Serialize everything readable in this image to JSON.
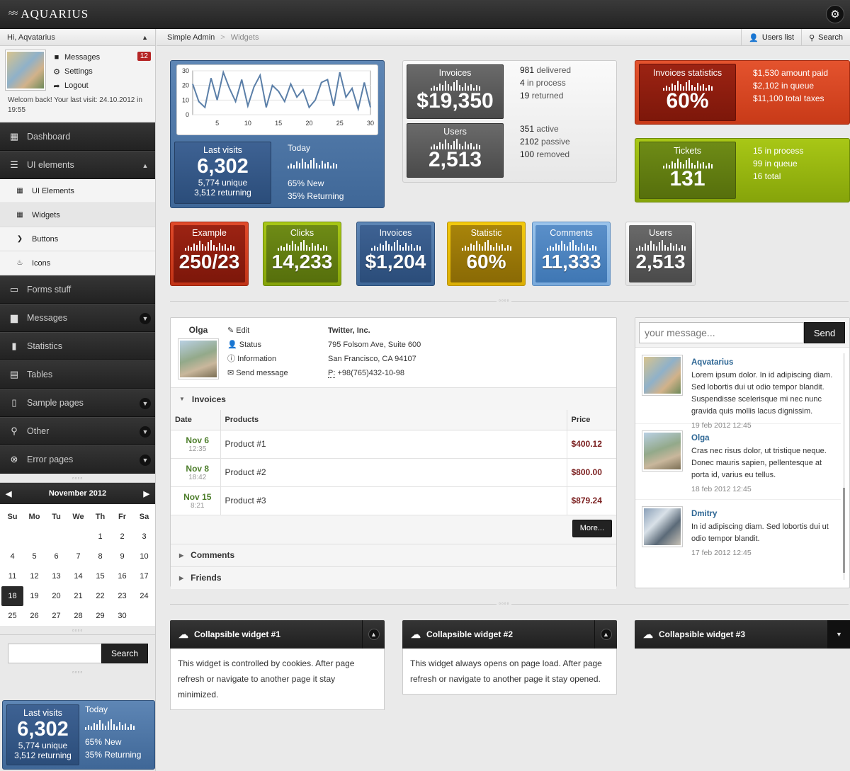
{
  "app": {
    "logo": "AQUARIUS"
  },
  "header": {
    "greeting": "Hi, Aqvatarius"
  },
  "user_box": {
    "messages_label": "Messages",
    "messages_count": "12",
    "settings_label": "Settings",
    "logout_label": "Logout",
    "welcome": "Welcom back! Your last visit: 24.10.2012 in 19:55"
  },
  "nav": {
    "dashboard": "Dashboard",
    "ui_elements": "UI elements",
    "sub": [
      "UI Elements",
      "Widgets",
      "Buttons",
      "Icons"
    ],
    "forms": "Forms stuff",
    "messages": "Messages",
    "statistics": "Statistics",
    "tables": "Tables",
    "sample_pages": "Sample pages",
    "other": "Other",
    "error_pages": "Error pages"
  },
  "calendar": {
    "month": "November 2012",
    "dow": [
      "Su",
      "Mo",
      "Tu",
      "We",
      "Th",
      "Fr",
      "Sa"
    ],
    "days": [
      "",
      "",
      "",
      "",
      "1",
      "2",
      "3",
      "4",
      "5",
      "6",
      "7",
      "8",
      "9",
      "10",
      "11",
      "12",
      "13",
      "14",
      "15",
      "16",
      "17",
      "18",
      "19",
      "20",
      "21",
      "22",
      "23",
      "24",
      "25",
      "26",
      "27",
      "28",
      "29",
      "30",
      ""
    ],
    "today": "18"
  },
  "side_search": {
    "button": "Search"
  },
  "visits": {
    "title": "Last visits",
    "value": "6,302",
    "unique": "5,774 unique",
    "returning": "3,512 returning",
    "today": "Today",
    "new_pct": "65%",
    "new_label": "New",
    "ret_pct": "35%",
    "ret_label": "Returning"
  },
  "breadcrumb": {
    "root": "Simple Admin",
    "current": "Widgets",
    "users_list": "Users list",
    "search": "Search"
  },
  "chart_data": {
    "type": "line",
    "x": [
      1,
      2,
      3,
      4,
      5,
      6,
      7,
      8,
      9,
      10,
      11,
      12,
      13,
      14,
      15,
      16,
      17,
      18,
      19,
      20,
      21,
      22,
      23,
      24,
      25,
      26,
      27,
      28,
      29,
      30
    ],
    "values": [
      21,
      9,
      5,
      25,
      10,
      29,
      18,
      9,
      24,
      6,
      19,
      27,
      5,
      20,
      16,
      9,
      21,
      12,
      17,
      5,
      10,
      22,
      24,
      6,
      29,
      12,
      18,
      4,
      22,
      5
    ],
    "xticks": [
      "5",
      "10",
      "15",
      "20",
      "25",
      "30"
    ],
    "yticks": [
      "0",
      "10",
      "20",
      "30"
    ],
    "ylim": [
      0,
      30
    ],
    "color": "#5b7fa8"
  },
  "invoices_box": {
    "invoices_title": "Invoices",
    "invoices_value": "$19,350",
    "delivered_n": "981",
    "delivered": "delivered",
    "process_n": "4",
    "process": "in process",
    "returned_n": "19",
    "returned": "returned",
    "users_title": "Users",
    "users_value": "2,513",
    "active_n": "351",
    "active": "active",
    "passive_n": "2102",
    "passive": "passive",
    "removed_n": "100",
    "removed": "removed"
  },
  "inv_stats": {
    "title": "Invoices statistics",
    "value": "60%",
    "line1": "$1,530 amount paid",
    "line2": "$2,102 in queue",
    "line3": "$11,100 total taxes"
  },
  "tickets": {
    "title": "Tickets",
    "value": "131",
    "line1": "15 in process",
    "line2": "99 in queue",
    "line3": "16 total"
  },
  "tiles": [
    {
      "title": "Example",
      "value": "250/23"
    },
    {
      "title": "Clicks",
      "value": "14,233"
    },
    {
      "title": "Invoices",
      "value": "$1,204"
    },
    {
      "title": "Statistic",
      "value": "60%"
    },
    {
      "title": "Comments",
      "value": "11,333"
    },
    {
      "title": "Users",
      "value": "2,513"
    }
  ],
  "profile": {
    "name": "Olga",
    "edit": "Edit",
    "status": "Status",
    "information": "Information",
    "send": "Send message",
    "company": "Twitter, Inc.",
    "addr1": "795 Folsom Ave, Suite 600",
    "addr2": "San Francisco, CA 94107",
    "phone_label": "P:",
    "phone": "+98(765)432-10-98"
  },
  "invoices_table": {
    "section": "Invoices",
    "headers": [
      "Date",
      "Products",
      "Price"
    ],
    "rows": [
      {
        "date": "Nov 6",
        "time": "12:35",
        "product": "Product #1",
        "price": "$400.12"
      },
      {
        "date": "Nov 8",
        "time": "18:42",
        "product": "Product #2",
        "price": "$800.00"
      },
      {
        "date": "Nov 15",
        "time": "8:21",
        "product": "Product #3",
        "price": "$879.24"
      }
    ],
    "more": "More...",
    "comments": "Comments",
    "friends": "Friends"
  },
  "chat": {
    "placeholder": "your message...",
    "send": "Send",
    "items": [
      {
        "name": "Aqvatarius",
        "text": "Lorem ipsum dolor. In id adipiscing diam. Sed lobortis dui ut odio tempor blandit. Suspendisse scelerisque mi nec nunc gravida quis mollis lacus dignissim.",
        "time": "19 feb 2012 12:45"
      },
      {
        "name": "Olga",
        "text": "Cras nec risus dolor, ut tristique neque. Donec mauris sapien, pellentesque at porta id, varius eu tellus.",
        "time": "18 feb 2012 12:45"
      },
      {
        "name": "Dmitry",
        "text": "In id adipiscing diam. Sed lobortis dui ut odio tempor blandit.",
        "time": "17 feb 2012 12:45"
      }
    ]
  },
  "widgets": [
    {
      "title": "Collapsible widget #1",
      "body": "This widget is controlled by cookies. After page refresh or navigate to another page it stay minimized."
    },
    {
      "title": "Collapsible widget #2",
      "body": "This widget always opens on page load. After page refresh or navigate to another page it stay opened."
    },
    {
      "title": "Collapsible widget #3",
      "body": ""
    }
  ]
}
